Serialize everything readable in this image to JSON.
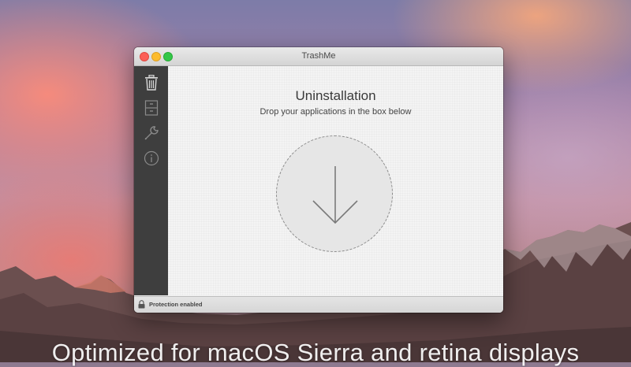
{
  "window": {
    "title": "TrashMe"
  },
  "sidebar": {
    "items": [
      {
        "name": "uninstall",
        "icon": "trash-icon"
      },
      {
        "name": "cleaner",
        "icon": "cabinet-icon"
      },
      {
        "name": "tools",
        "icon": "wrench-icon"
      },
      {
        "name": "about",
        "icon": "info-icon"
      }
    ]
  },
  "main": {
    "heading": "Uninstallation",
    "subheading": "Drop your applications in the box below",
    "dropzone_icon": "arrow-down-icon"
  },
  "status": {
    "text": "Protection enabled",
    "icon": "lock-icon"
  },
  "promo": {
    "tagline": "Optimized for macOS Sierra and retina displays"
  },
  "colors": {
    "sidebar_bg": "#3e3e3e",
    "close": "#fc5f57",
    "minimize": "#fdbc2e",
    "maximize": "#33c748"
  }
}
